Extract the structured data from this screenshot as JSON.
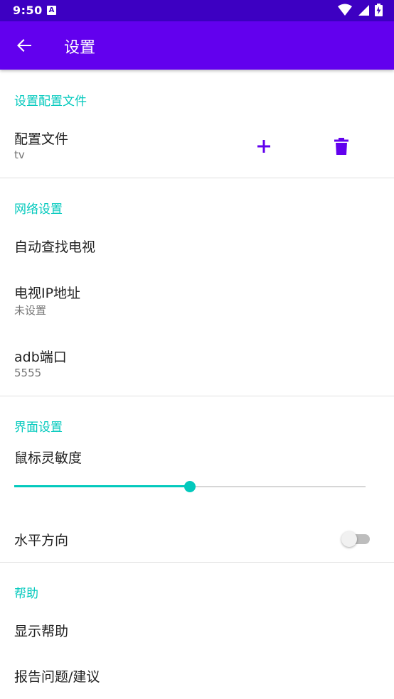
{
  "status_bar": {
    "time": "9:50",
    "notification_badge": "A",
    "icons": [
      "wifi-icon",
      "signal-icon",
      "battery-charging-icon"
    ]
  },
  "app_bar": {
    "title": "设置",
    "back_icon": "arrow-back-icon"
  },
  "sections": {
    "profile": {
      "header": "设置配置文件",
      "item": {
        "title": "配置文件",
        "summary": "tv"
      },
      "add_icon": "plus-icon",
      "delete_icon": "trash-icon"
    },
    "network": {
      "header": "网络设置",
      "auto_find": {
        "title": "自动查找电视"
      },
      "tv_ip": {
        "title": "电视IP地址",
        "summary": "未设置"
      },
      "adb_port": {
        "title": "adb端口",
        "summary": "5555"
      }
    },
    "interface": {
      "header": "界面设置",
      "sensitivity": {
        "title": "鼠标灵敏度",
        "value_fraction": 0.5
      },
      "horizontal": {
        "title": "水平方向",
        "checked": false
      }
    },
    "help": {
      "header": "帮助",
      "show_help": {
        "title": "显示帮助"
      },
      "report": {
        "title": "报告问题/建议"
      }
    }
  },
  "colors": {
    "status_bar": "#3d00c2",
    "app_bar": "#6200ee",
    "accent": "#03c9bd",
    "icon_purple": "#6200ee"
  }
}
